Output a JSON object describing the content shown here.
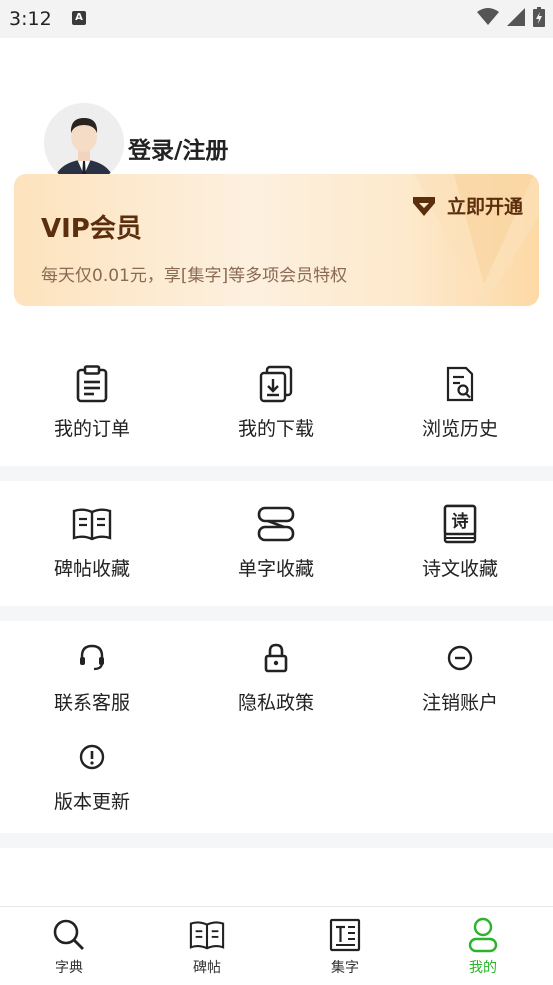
{
  "status_bar": {
    "time": "3:12",
    "badge": "A"
  },
  "profile": {
    "login_label": "登录/注册"
  },
  "vip": {
    "title": "VIP会员",
    "description": "每天仅0.01元，享[集字]等多项会员特权",
    "action_label": "立即开通"
  },
  "menu_group_1": [
    {
      "label": "我的订单",
      "icon": "clipboard-icon"
    },
    {
      "label": "我的下载",
      "icon": "download-icon"
    },
    {
      "label": "浏览历史",
      "icon": "history-icon"
    }
  ],
  "menu_group_2": [
    {
      "label": "碑帖收藏",
      "icon": "book-open-icon"
    },
    {
      "label": "单字收藏",
      "icon": "stack-icon"
    },
    {
      "label": "诗文收藏",
      "icon": "poem-book-icon",
      "glyph": "诗"
    }
  ],
  "menu_group_3": [
    {
      "label": "联系客服",
      "icon": "headset-icon"
    },
    {
      "label": "隐私政策",
      "icon": "lock-icon"
    },
    {
      "label": "注销账户",
      "icon": "minus-circle-icon"
    },
    {
      "label": "版本更新",
      "icon": "info-circle-icon"
    }
  ],
  "tabbar": {
    "items": [
      {
        "label": "字典",
        "icon": "search-icon"
      },
      {
        "label": "碑帖",
        "icon": "book-icon"
      },
      {
        "label": "集字",
        "icon": "text-doc-icon"
      },
      {
        "label": "我的",
        "icon": "user-icon"
      }
    ],
    "active_index": 3,
    "active_color": "#2bb32b"
  },
  "colors": {
    "vip_text": "#5b2e0e",
    "separator": "#f5f6f7"
  }
}
